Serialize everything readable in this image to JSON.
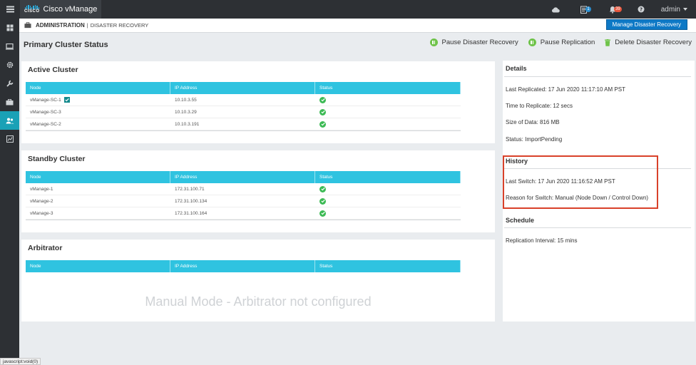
{
  "app": {
    "brand_logo": "CISCO",
    "brand_name": "Cisco vManage"
  },
  "topbar": {
    "icons": [
      "cloud-icon",
      "tasks-icon",
      "bell-icon",
      "help-icon"
    ],
    "tasks_badge": "1",
    "alerts_badge": "39",
    "user": "admin"
  },
  "sidebar": {
    "items": [
      "dashboard-icon",
      "monitor-icon",
      "configuration-icon",
      "tools-icon",
      "maintenance-icon",
      "administration-icon",
      "analytics-icon"
    ],
    "active_index": 5
  },
  "breadcrumb": {
    "section": "ADMINISTRATION",
    "separator": "|",
    "page": "DISASTER RECOVERY"
  },
  "header": {
    "manage_button": "Manage Disaster Recovery"
  },
  "page": {
    "title": "Primary Cluster Status"
  },
  "actions": {
    "pause_dr": "Pause Disaster Recovery",
    "pause_replication": "Pause Replication",
    "delete_dr": "Delete Disaster Recovery"
  },
  "columns": {
    "node": "Node",
    "ip": "IP Address",
    "status": "Status"
  },
  "active_cluster": {
    "title": "Active Cluster",
    "rows": [
      {
        "node": "vManage-SC-1",
        "ip": "10.10.3.55",
        "status": "ok",
        "selected": true
      },
      {
        "node": "vManage-SC-3",
        "ip": "10.10.3.29",
        "status": "ok"
      },
      {
        "node": "vManage-SC-2",
        "ip": "10.10.3.191",
        "status": "ok"
      }
    ]
  },
  "standby_cluster": {
    "title": "Standby Cluster",
    "rows": [
      {
        "node": "vManage-1",
        "ip": "172.31.100.71",
        "status": "ok"
      },
      {
        "node": "vManage-2",
        "ip": "172.31.100.134",
        "status": "ok"
      },
      {
        "node": "vManage-3",
        "ip": "172.31.100.164",
        "status": "ok"
      }
    ]
  },
  "arbitrator": {
    "title": "Arbitrator",
    "empty_message": "Manual Mode - Arbitrator not configured"
  },
  "details": {
    "title": "Details",
    "last_replicated": "Last Replicated: 17 Jun 2020 11:17:10 AM PST",
    "time_to_replicate": "Time to Replicate: 12 secs",
    "size_of_data": "Size of Data: 816 MB",
    "status": "Status: ImportPending"
  },
  "history": {
    "title": "History",
    "last_switch": "Last Switch: 17 Jun 2020 11:16:52 AM PST",
    "reason": "Reason for Switch: Manual (Node Down / Control Down)"
  },
  "schedule": {
    "title": "Schedule",
    "interval": "Replication Interval: 15 mins"
  },
  "statusbar": {
    "text": "javascript:void(0)"
  },
  "colors": {
    "accent": "#2fc3e0",
    "brand_button": "#0e79c6",
    "ok": "#3cba54",
    "highlight": "#d9412a"
  }
}
